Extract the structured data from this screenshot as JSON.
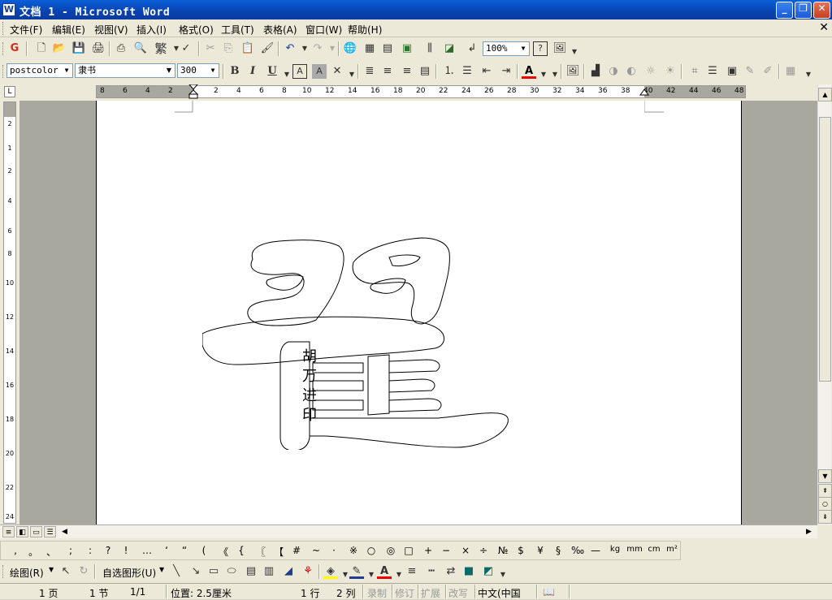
{
  "window": {
    "title": "文档 1 - Microsoft Word",
    "app_icon": "W"
  },
  "menu": {
    "items": [
      "文件(F)",
      "编辑(E)",
      "视图(V)",
      "插入(I)",
      "格式(O)",
      "工具(T)",
      "表格(A)",
      "窗口(W)",
      "帮助(H)"
    ]
  },
  "standard_toolbar": {
    "zoom": "100%",
    "traditional_label": "繁"
  },
  "format_toolbar": {
    "style": "postcolor",
    "font": "隶书",
    "size": "300",
    "bold": "B",
    "italic": "I",
    "underline": "U",
    "font_color_letter": "A"
  },
  "ruler": {
    "h_ticks": [
      "8",
      "6",
      "4",
      "2",
      "2",
      "4",
      "6",
      "8",
      "10",
      "12",
      "14",
      "16",
      "18",
      "20",
      "22",
      "24",
      "26",
      "28",
      "30",
      "32",
      "34",
      "36",
      "38",
      "40",
      "42",
      "44",
      "46",
      "48"
    ],
    "v_ticks": [
      "2",
      "1",
      "2",
      "4",
      "6",
      "8",
      "10",
      "12",
      "14",
      "16",
      "18",
      "20",
      "22",
      "24"
    ]
  },
  "document": {
    "seal_text": [
      "胡",
      "万",
      "进",
      "印"
    ],
    "large_character": "翟"
  },
  "symbol_bar": {
    "symbols": [
      ",",
      "。",
      "、",
      ";",
      ":",
      "?",
      "!",
      "…",
      "‘",
      "“",
      "(",
      "《",
      "{",
      "〖",
      "【",
      "#",
      "~",
      "·",
      "※",
      "○",
      "◎",
      "□",
      "+",
      "−",
      "×",
      "÷",
      "№",
      "$",
      "¥",
      "§",
      "‰",
      "—",
      "kg",
      "mm",
      "cm",
      "m²"
    ]
  },
  "drawing_bar": {
    "draw_label": "绘图(R)",
    "autoshape_label": "自选图形(U)"
  },
  "status": {
    "page": "1 页",
    "section": "1 节",
    "page_of": "1/1",
    "position": "位置: 2.5厘米",
    "line": "1 行",
    "column": "2 列",
    "rec": "录制",
    "trk": "修订",
    "ext": "扩展",
    "ovr": "改写",
    "language": "中文(中国"
  }
}
